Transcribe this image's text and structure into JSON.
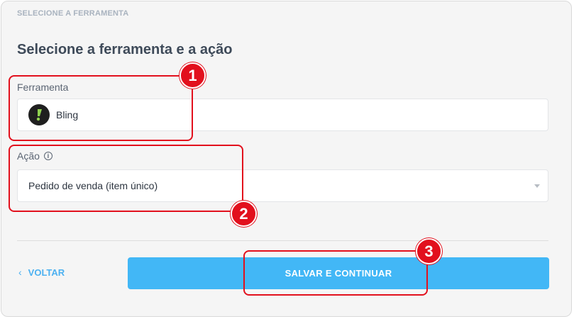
{
  "section": {
    "label": "SELECIONE A FERRAMENTA"
  },
  "title": "Selecione a ferramenta e a ação",
  "tool_field": {
    "label": "Ferramenta",
    "value": "Bling",
    "logo_icon": "bling-logo-icon"
  },
  "action_field": {
    "label": "Ação",
    "info_glyph": "i",
    "value": "Pedido de venda (item único)"
  },
  "footer": {
    "back_label": "VOLTAR",
    "back_chevron": "‹",
    "submit_label": "SALVAR E CONTINUAR"
  },
  "annotations": {
    "step1": "1",
    "step2": "2",
    "step3": "3",
    "color": "#e2101d"
  },
  "colors": {
    "accent": "#42b7f6",
    "link": "#4db1f1",
    "title": "#3e4a59"
  }
}
